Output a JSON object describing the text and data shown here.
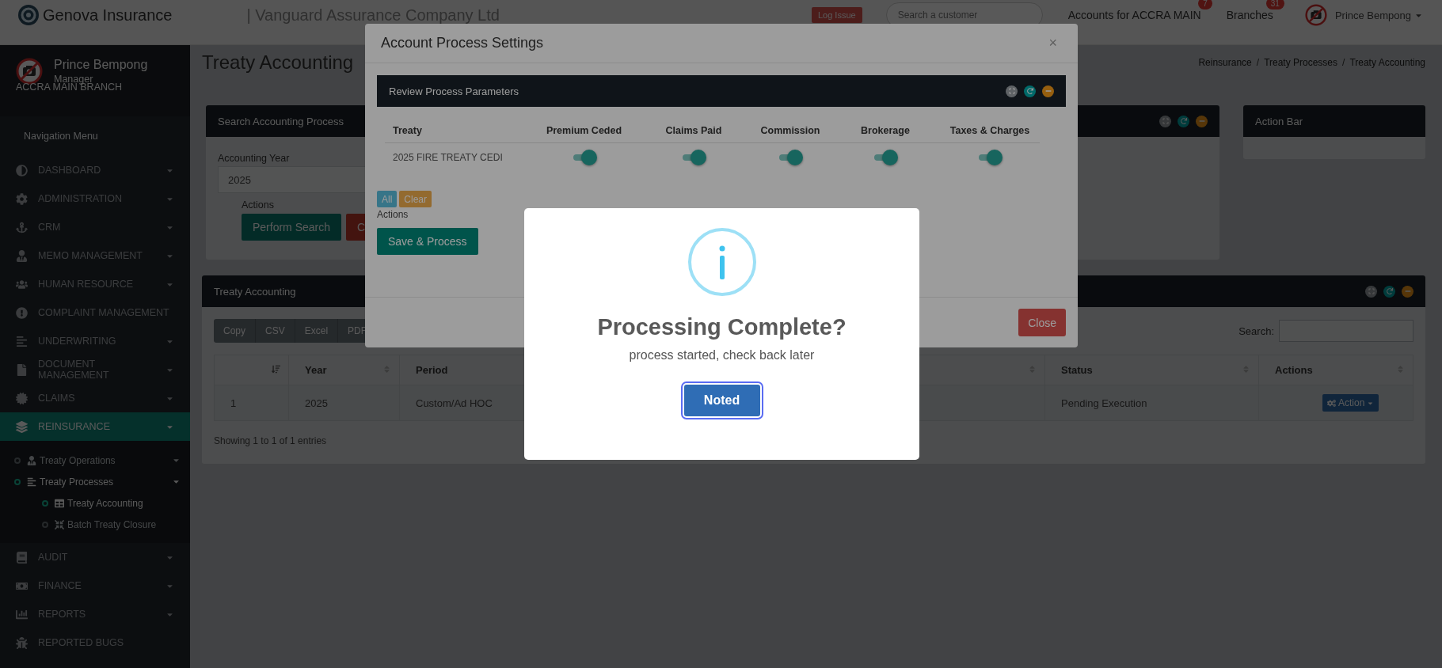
{
  "header": {
    "brand": "Genova Insurance",
    "company": "| Vanguard Assurance Company Ltd",
    "log_issue": "Log Issue",
    "search": {
      "placeholder": "Search a customer"
    },
    "links": [
      {
        "label": "Accounts for ACCRA MAIN",
        "badge": "7"
      },
      {
        "label": "Branches",
        "badge": "31"
      }
    ],
    "user": "Prince Bempong"
  },
  "sidebar": {
    "profile": {
      "name": "Prince Bempong",
      "role": "Manager",
      "branch": "ACCRA MAIN BRANCH"
    },
    "heading": "Navigation Menu",
    "items": [
      {
        "label": "DASHBOARD",
        "submenu": true,
        "selected": false
      },
      {
        "label": "ADMINISTRATION",
        "submenu": true,
        "selected": false
      },
      {
        "label": "CRM",
        "submenu": true,
        "selected": false
      },
      {
        "label": "MEMO MANAGEMENT",
        "submenu": true,
        "selected": false
      },
      {
        "label": "HUMAN RESOURCE",
        "submenu": true,
        "selected": false
      },
      {
        "label": "COMPLAINT MANAGEMENT",
        "submenu": false,
        "selected": false
      },
      {
        "label": "UNDERWRITING",
        "submenu": true,
        "selected": false
      },
      {
        "label": "DOCUMENT MANAGEMENT",
        "submenu": true,
        "selected": false
      },
      {
        "label": "CLAIMS",
        "submenu": true,
        "selected": false
      },
      {
        "label": "REINSURANCE",
        "submenu": true,
        "selected": true,
        "children": [
          {
            "label": "Treaty Operations",
            "submenu": true,
            "selected": false
          },
          {
            "label": "Treaty Processes",
            "submenu": true,
            "selected": true,
            "children": [
              {
                "label": "Treaty Accounting",
                "submenu": false,
                "selected": true
              },
              {
                "label": "Batch Treaty Closure",
                "submenu": false,
                "selected": false
              }
            ]
          }
        ]
      },
      {
        "label": "AUDIT",
        "submenu": true,
        "selected": false
      },
      {
        "label": "FINANCE",
        "submenu": true,
        "selected": false
      },
      {
        "label": "REPORTS",
        "submenu": true,
        "selected": false
      },
      {
        "label": "REPORTED BUGS",
        "submenu": false,
        "selected": false
      }
    ]
  },
  "page": {
    "title": "Treaty Accounting",
    "breadcrumb": [
      {
        "label": "Reinsurance"
      },
      {
        "separator": "/",
        "label": "Treaty Processes"
      },
      {
        "separator": "/",
        "label": "Treaty Accounting"
      }
    ]
  },
  "search_panel": {
    "title": "Search Accounting Process",
    "year_label": "Accounting Year",
    "year_value": "2025",
    "actions_label": "Actions",
    "buttons": [
      {
        "label": "Perform Search",
        "kind": "primary"
      },
      {
        "label": "C",
        "kind": "danger"
      }
    ]
  },
  "action_bar": {
    "title": "Action Bar"
  },
  "table_panel": {
    "title": "Treaty Accounting",
    "export_buttons": [
      "Copy",
      "CSV",
      "Excel",
      "PDF"
    ],
    "search_label": "Search:",
    "columns": [
      {
        "sorted": true
      },
      {
        "label": "Year",
        "sorted": false
      },
      {
        "label": "Period"
      },
      {
        "sorted": false
      },
      {
        "label": "Status",
        "sorted": false
      },
      {
        "label": "Actions",
        "sorted": false
      }
    ],
    "rows": [
      {
        "index": "1",
        "year": "2025",
        "period": "Custom/Ad HOC",
        "status": "Pending Execution",
        "action": "Action"
      }
    ],
    "info": "Showing 1 to 1 of 1 entries"
  },
  "modal": {
    "title": "Account Process Settings",
    "close": "×",
    "panel_title": "Review Process Parameters",
    "columns": [
      "Treaty",
      "Premium Ceded",
      "Claims Paid",
      "Commission",
      "Brokerage",
      "Taxes & Charges"
    ],
    "rows": [
      {
        "treaty": "2025 FIRE TREATY CEDI",
        "toggles": [
          {
            "on": true
          },
          {
            "on": true
          },
          {
            "on": true
          },
          {
            "on": true
          },
          {
            "on": true
          }
        ]
      }
    ],
    "quick_buttons": [
      {
        "label": "All",
        "kind": "select"
      },
      {
        "label": "Clear",
        "kind": "clear"
      }
    ],
    "actions_label": "Actions",
    "save": "Save & Process",
    "footer_button": "Close"
  },
  "alert": {
    "title": "Processing Complete?",
    "text": "process started, check back later",
    "button": {
      "label": "Noted",
      "focused": true
    }
  }
}
